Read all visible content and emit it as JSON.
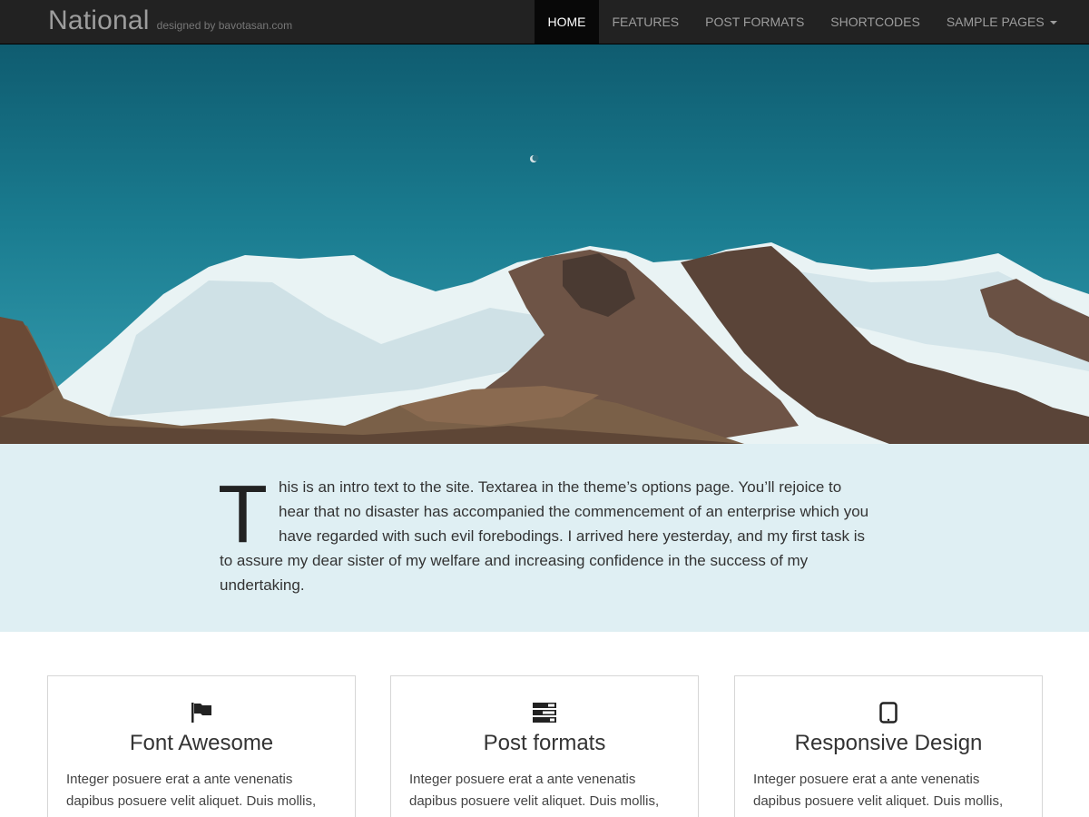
{
  "site": {
    "name": "National",
    "tagline": "designed by bavotasan.com"
  },
  "nav": {
    "items": [
      {
        "label": "HOME",
        "active": true
      },
      {
        "label": "FEATURES",
        "active": false
      },
      {
        "label": "POST FORMATS",
        "active": false
      },
      {
        "label": "SHORTCODES",
        "active": false
      },
      {
        "label": "SAMPLE PAGES",
        "active": false,
        "dropdown": true
      }
    ]
  },
  "hero": {
    "image": "snowy-mountain-range-with-moon"
  },
  "intro": {
    "dropcap": "T",
    "text": "his is an intro text to the site. Textarea in the theme’s options page. You’ll rejoice to hear that no disaster has accompanied the commencement of an enterprise which you have regarded with such evil forebodings. I arrived here yesterday, and my first task is to assure my dear sister of my welfare and increasing confidence in the success of my undertaking."
  },
  "features": [
    {
      "icon": "flag-icon",
      "title": "Font Awesome",
      "text": "Integer posuere erat a ante venenatis dapibus posuere velit aliquet. Duis mollis,"
    },
    {
      "icon": "tasks-icon",
      "title": "Post formats",
      "text": "Integer posuere erat a ante venenatis dapibus posuere velit aliquet. Duis mollis,"
    },
    {
      "icon": "tablet-icon",
      "title": "Responsive Design",
      "text": "Integer posuere erat a ante venenatis dapibus posuere velit aliquet. Duis mollis,"
    }
  ],
  "colors": {
    "navbar": "#222222",
    "nav_active": "#080808",
    "intro_bg": "#dfeff3",
    "sky": "#1a7c90"
  }
}
